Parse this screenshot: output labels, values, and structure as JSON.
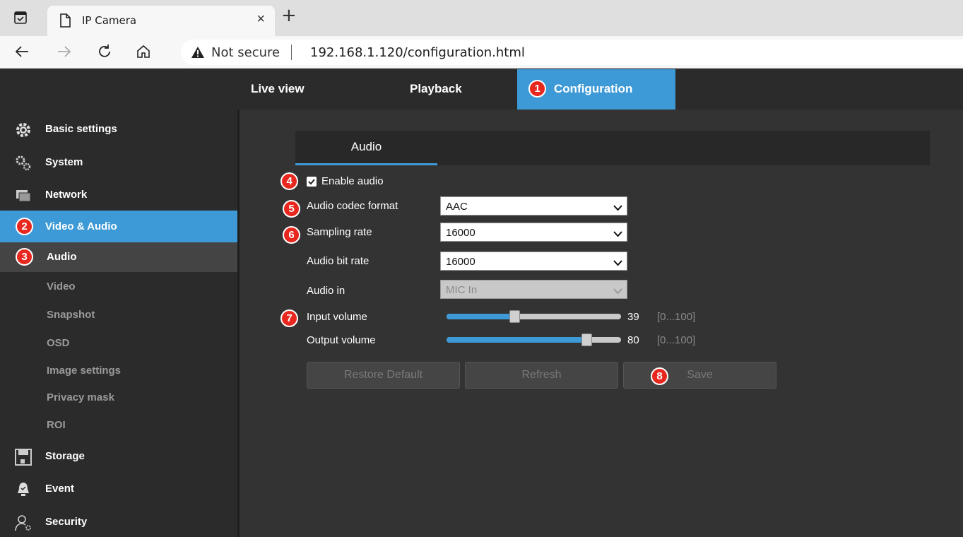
{
  "browser": {
    "tab_title": "IP Camera",
    "tab_close": "×",
    "new_tab": "+",
    "security_label": "Not secure",
    "url": "192.168.1.120/configuration.html"
  },
  "header": {
    "tabs": [
      {
        "label": "Live view"
      },
      {
        "label": "Playback"
      },
      {
        "label": "Configuration",
        "active": true
      }
    ]
  },
  "sidebar": {
    "items": [
      {
        "label": "Basic settings",
        "icon": "gear-icon"
      },
      {
        "label": "System",
        "icon": "gears-icon"
      },
      {
        "label": "Network",
        "icon": "network-icon"
      },
      {
        "label": "Video & Audio",
        "icon": "video-audio-icon",
        "active": true
      },
      {
        "label": "Audio",
        "current": true
      },
      {
        "label": "Video"
      },
      {
        "label": "Snapshot"
      },
      {
        "label": "OSD"
      },
      {
        "label": "Image settings"
      },
      {
        "label": "Privacy mask"
      },
      {
        "label": "ROI"
      },
      {
        "label": "Storage",
        "icon": "floppy-icon"
      },
      {
        "label": "Event",
        "icon": "bell-icon"
      },
      {
        "label": "Security",
        "icon": "user-gear-icon"
      }
    ]
  },
  "main": {
    "subtab": "Audio",
    "enable_audio": {
      "label": "Enable audio",
      "checked": true
    },
    "fields": {
      "codec": {
        "label": "Audio codec format",
        "value": "AAC"
      },
      "sampling": {
        "label": "Sampling rate",
        "value": "16000"
      },
      "bitrate": {
        "label": "Audio bit rate",
        "value": "16000"
      },
      "audio_in": {
        "label": "Audio in",
        "value": "MIC In",
        "disabled": true
      }
    },
    "sliders": {
      "input": {
        "label": "Input volume",
        "value": "39",
        "range": "[0...100]"
      },
      "output": {
        "label": "Output volume",
        "value": "80",
        "range": "[0...100]"
      }
    },
    "buttons": {
      "restore": "Restore Default",
      "refresh": "Refresh",
      "save": "Save"
    }
  },
  "badges": [
    "1",
    "2",
    "3",
    "4",
    "5",
    "6",
    "7",
    "8"
  ],
  "colors": {
    "accent": "#3d9ad6",
    "badge": "#e8281e"
  }
}
